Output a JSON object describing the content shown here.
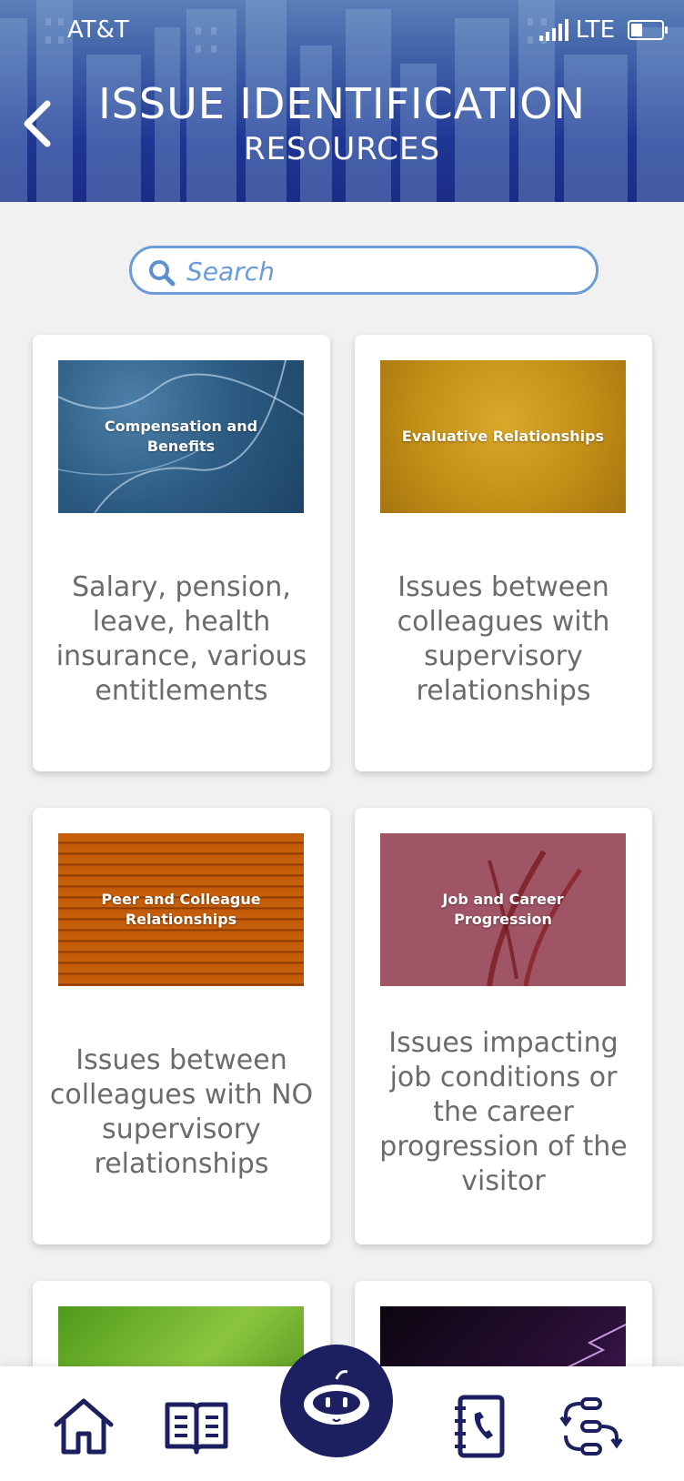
{
  "status_bar": {
    "carrier": "AT&T",
    "network": "LTE"
  },
  "header": {
    "title": "ISSUE IDENTIFICATION",
    "subtitle": "RESOURCES"
  },
  "search": {
    "placeholder": "Search"
  },
  "cards": [
    {
      "image_label": "Compensation and Benefits",
      "description": "Salary, pension, leave, health insurance, various entitlements"
    },
    {
      "image_label": "Evaluative Relationships",
      "description": "Issues between colleagues with supervisory relationships"
    },
    {
      "image_label": "Peer and Colleague Relationships",
      "description": "Issues between colleagues with NO supervisory relationships"
    },
    {
      "image_label": "Job and Career Progression",
      "description": "Issues impacting job conditions or the career progression of the visitor"
    }
  ],
  "bottom_nav": {
    "items": [
      {
        "icon": "home-icon"
      },
      {
        "icon": "book-icon"
      },
      {
        "icon": "chatbot-icon"
      },
      {
        "icon": "contacts-phone-icon"
      },
      {
        "icon": "workflow-icon"
      }
    ]
  },
  "colors": {
    "header_blue": "#1f3593",
    "nav_icon": "#1c2060",
    "search_border": "#6b9bd8",
    "description_text": "#6b6b6b"
  }
}
